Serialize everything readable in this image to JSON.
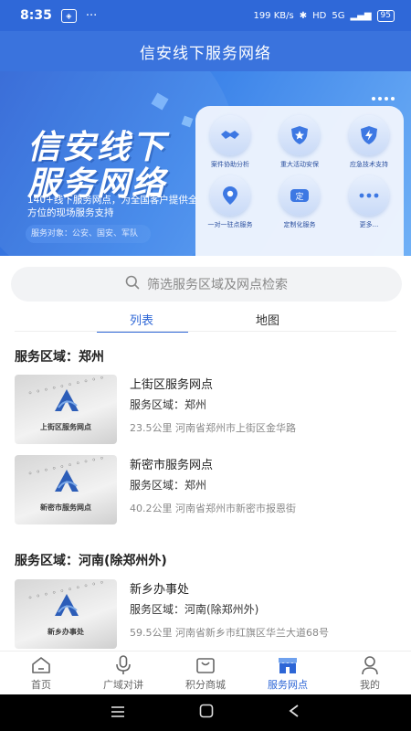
{
  "status_bar": {
    "time": "8:35",
    "network_speed": "199 KB/s",
    "signal": "5G",
    "battery": "95"
  },
  "header": {
    "title": "信安线下服务网络"
  },
  "banner": {
    "title_line1": "信安线下",
    "title_line2": "服务网络",
    "description": "140+线下服务网点，为全国客户提供全方位的现场服务支持",
    "service_target": "服务对象：公安、国安、军队",
    "services": [
      {
        "label": "案件协助分析",
        "icon": "handshake-icon"
      },
      {
        "label": "重大活动安保",
        "icon": "shield-star-icon"
      },
      {
        "label": "应急技术支持",
        "icon": "lightning-shield-icon"
      },
      {
        "label": "一对一驻点服务",
        "icon": "location-pin-icon"
      },
      {
        "label": "定制化服务",
        "icon": "custom-badge-icon"
      },
      {
        "label": "更多...",
        "icon": "more-dots-icon"
      }
    ]
  },
  "search": {
    "placeholder": "筛选服务区域及网点检索"
  },
  "tabs": [
    {
      "label": "列表",
      "active": true
    },
    {
      "label": "地图",
      "active": false
    }
  ],
  "regions": [
    {
      "title": "服务区域：郑州",
      "items": [
        {
          "thumb_label": "上街区服务网点",
          "name": "上街区服务网点",
          "region": "服务区域：郑州",
          "address": "23.5公里 河南省郑州市上街区金华路"
        },
        {
          "thumb_label": "新密市服务网点",
          "name": "新密市服务网点",
          "region": "服务区域：郑州",
          "address": "40.2公里 河南省郑州市新密市报恩街"
        }
      ]
    },
    {
      "title": "服务区域：河南(除郑州外)",
      "items": [
        {
          "thumb_label": "新乡办事处",
          "name": "新乡办事处",
          "region": "服务区域：河南(除郑州外)",
          "address": "59.5公里 河南省新乡市红旗区华兰大道68号"
        }
      ]
    }
  ],
  "bottom_nav": [
    {
      "label": "首页",
      "icon": "home-icon",
      "active": false
    },
    {
      "label": "广域对讲",
      "icon": "microphone-icon",
      "active": false
    },
    {
      "label": "积分商城",
      "icon": "shopping-bag-icon",
      "active": false
    },
    {
      "label": "服务网点",
      "icon": "store-icon",
      "active": true
    },
    {
      "label": "我的",
      "icon": "user-icon",
      "active": false
    }
  ],
  "colors": {
    "primary": "#2d66d6",
    "header": "#3a73dd",
    "text_muted": "#888888"
  }
}
